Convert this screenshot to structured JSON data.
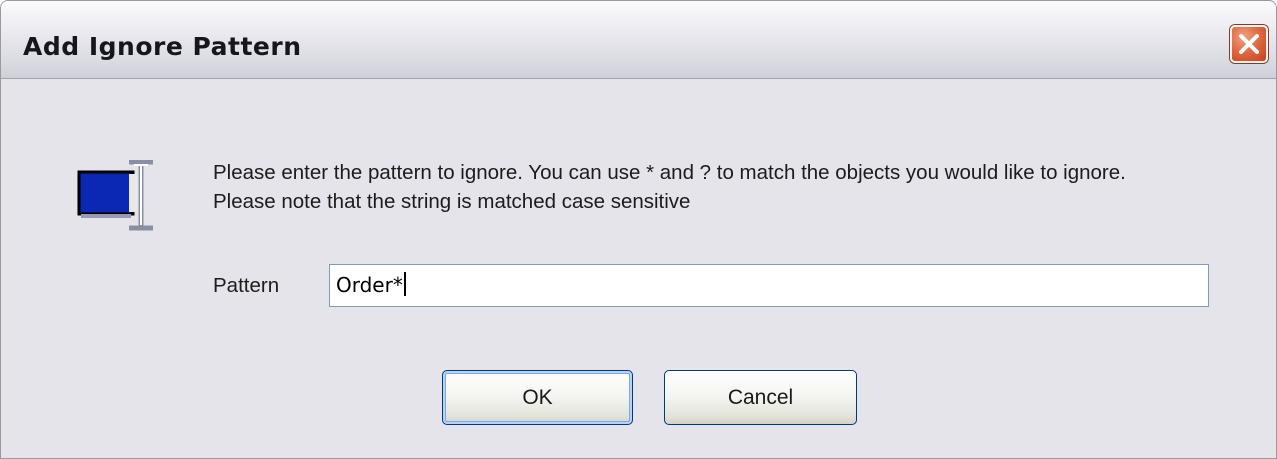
{
  "window": {
    "title": "Add Ignore Pattern"
  },
  "icons": {
    "close": "close-icon",
    "dialog": "computer-text-cursor-icon"
  },
  "message": "Please enter the pattern to ignore. You can use * and ? to match the objects you would like to ignore. Please note that the string is matched case sensitive",
  "pattern": {
    "label": "Pattern",
    "value": "Order*"
  },
  "buttons": {
    "ok_label": "OK",
    "cancel_label": "Cancel"
  },
  "colors": {
    "close_button": "#e16b42",
    "dialog_icon_screen": "#0a28b4",
    "default_button_focus": "#7fa9e6"
  }
}
